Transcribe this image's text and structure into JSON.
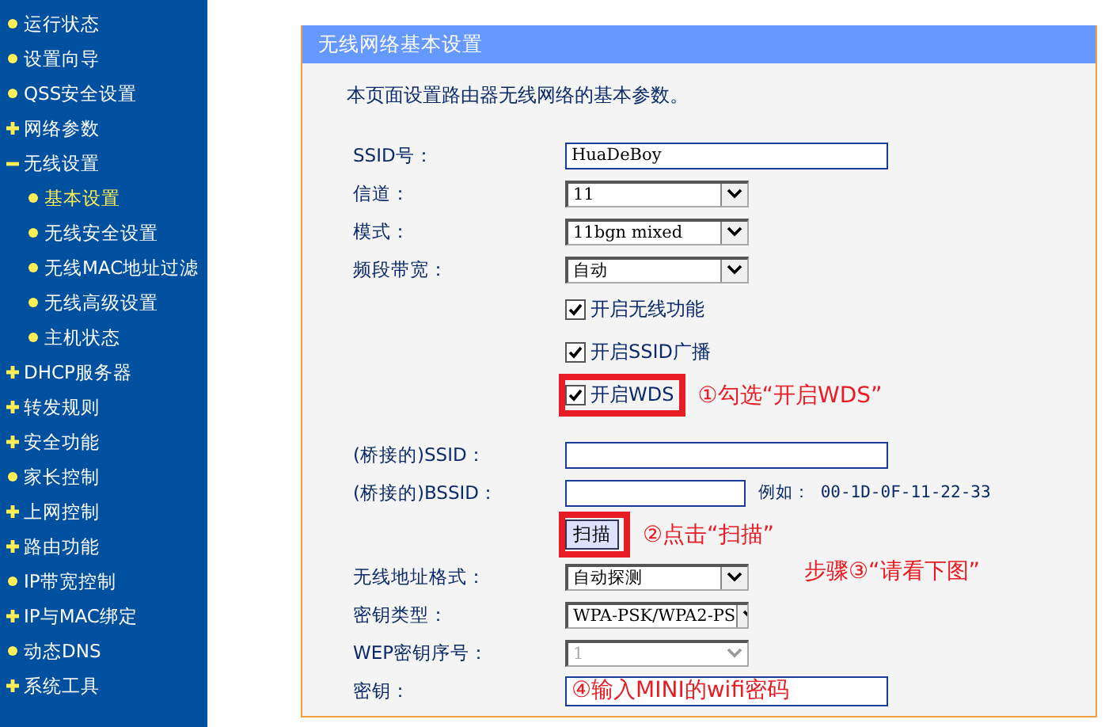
{
  "sidebar": {
    "items": [
      {
        "label": "运行状态",
        "kind": "leaf",
        "selected": false
      },
      {
        "label": "设置向导",
        "kind": "leaf",
        "selected": false
      },
      {
        "label": "QSS安全设置",
        "kind": "leaf",
        "selected": false
      },
      {
        "label": "网络参数",
        "kind": "group",
        "expanded": false,
        "selected": false
      },
      {
        "label": "无线设置",
        "kind": "group",
        "expanded": true,
        "selected": false,
        "children": [
          {
            "label": "基本设置",
            "kind": "leaf",
            "selected": true
          },
          {
            "label": "无线安全设置",
            "kind": "leaf",
            "selected": false
          },
          {
            "label": "无线MAC地址过滤",
            "kind": "leaf",
            "selected": false
          },
          {
            "label": "无线高级设置",
            "kind": "leaf",
            "selected": false
          },
          {
            "label": "主机状态",
            "kind": "leaf",
            "selected": false
          }
        ]
      },
      {
        "label": "DHCP服务器",
        "kind": "group",
        "expanded": false,
        "selected": false
      },
      {
        "label": "转发规则",
        "kind": "group",
        "expanded": false,
        "selected": false
      },
      {
        "label": "安全功能",
        "kind": "group",
        "expanded": false,
        "selected": false
      },
      {
        "label": "家长控制",
        "kind": "leaf",
        "selected": false
      },
      {
        "label": "上网控制",
        "kind": "group",
        "expanded": false,
        "selected": false
      },
      {
        "label": "路由功能",
        "kind": "group",
        "expanded": false,
        "selected": false
      },
      {
        "label": "IP带宽控制",
        "kind": "leaf",
        "selected": false
      },
      {
        "label": "IP与MAC绑定",
        "kind": "group",
        "expanded": false,
        "selected": false
      },
      {
        "label": "动态DNS",
        "kind": "leaf",
        "selected": false
      },
      {
        "label": "系统工具",
        "kind": "group",
        "expanded": false,
        "selected": false
      }
    ]
  },
  "panel": {
    "title": "无线网络基本设置",
    "description": "本页面设置路由器无线网络的基本参数。",
    "fields": [
      {
        "kind": "text",
        "label": "SSID号：",
        "value": "HuaDeBoy"
      },
      {
        "kind": "select",
        "label": "信道：",
        "value": "11",
        "disabled": false
      },
      {
        "kind": "select",
        "label": "模式：",
        "value": "11bgn mixed",
        "disabled": false
      },
      {
        "kind": "select",
        "label": "频段带宽：",
        "value": "自动",
        "disabled": false
      },
      {
        "kind": "checkbox",
        "label": "开启无线功能",
        "checked": true,
        "highlighted": false
      },
      {
        "kind": "checkbox",
        "label": "开启SSID广播",
        "checked": true,
        "highlighted": false
      },
      {
        "kind": "checkbox",
        "label": "开启WDS",
        "checked": true,
        "highlighted": true,
        "annotation": "①勾选“开启WDS”"
      },
      {
        "kind": "text",
        "label": "(桥接的)SSID："
      },
      {
        "kind": "text",
        "label": "(桥接的)BSSID：",
        "hint": "例如： 00-1D-0F-11-22-33"
      },
      {
        "kind": "button",
        "label": "扫描",
        "highlighted": true,
        "annotation": "②点击“扫描”"
      },
      {
        "kind": "select",
        "label": "无线地址格式：",
        "value": "自动探测",
        "disabled": false
      },
      {
        "kind": "select",
        "label": "密钥类型：",
        "value": "WPA-PSK/WPA2-PS",
        "disabled": false
      },
      {
        "kind": "select",
        "label": "WEP密钥序号：",
        "value": "1",
        "disabled": true
      },
      {
        "kind": "text",
        "label": "密钥：",
        "annotation": "④输入MINI的wifi密码"
      }
    ],
    "note": "步骤③“请看下图”"
  }
}
